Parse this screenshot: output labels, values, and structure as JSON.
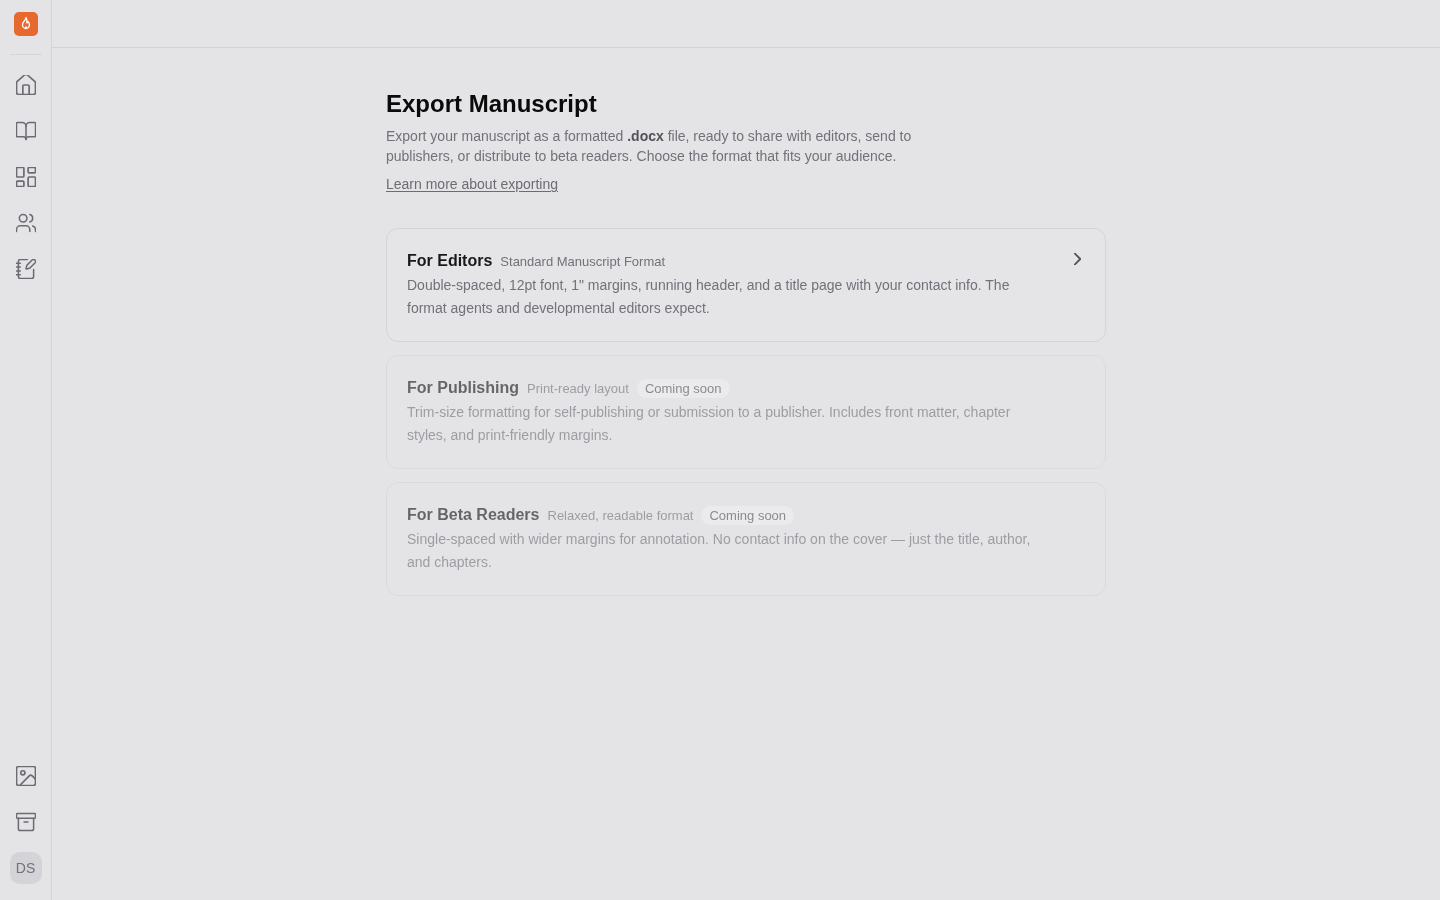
{
  "sidebar": {
    "avatar": {
      "initials": "DS"
    }
  },
  "page": {
    "title": "Export Manuscript",
    "description": "Export your manuscript as a formatted **.docx** file, ready to share with editors, send to publishers, or distribute to beta readers. Choose the format that fits your audience.",
    "link": "Learn more about exporting"
  },
  "export_options": [
    {
      "title": "For Editors",
      "subtitle": "Standard Manuscript Format",
      "description": "Double-spaced, 12pt font, 1\" margins, running header, and a title page with your contact info. The format agents and developmental editors expect.",
      "disabled": false
    },
    {
      "title": "For Publishing",
      "subtitle": "Print-ready layout",
      "badge": "Coming soon",
      "description": "Trim-size formatting for self-publishing or submission to a publisher. Includes front matter, chapter styles, and print-friendly margins.",
      "disabled": true
    },
    {
      "title": "For Beta Readers",
      "subtitle": "Relaxed, readable format",
      "badge": "Coming soon",
      "description": "Single-spaced with wider margins for annotation. No contact info on the cover — just the title, author, and chapters.",
      "disabled": true
    }
  ]
}
